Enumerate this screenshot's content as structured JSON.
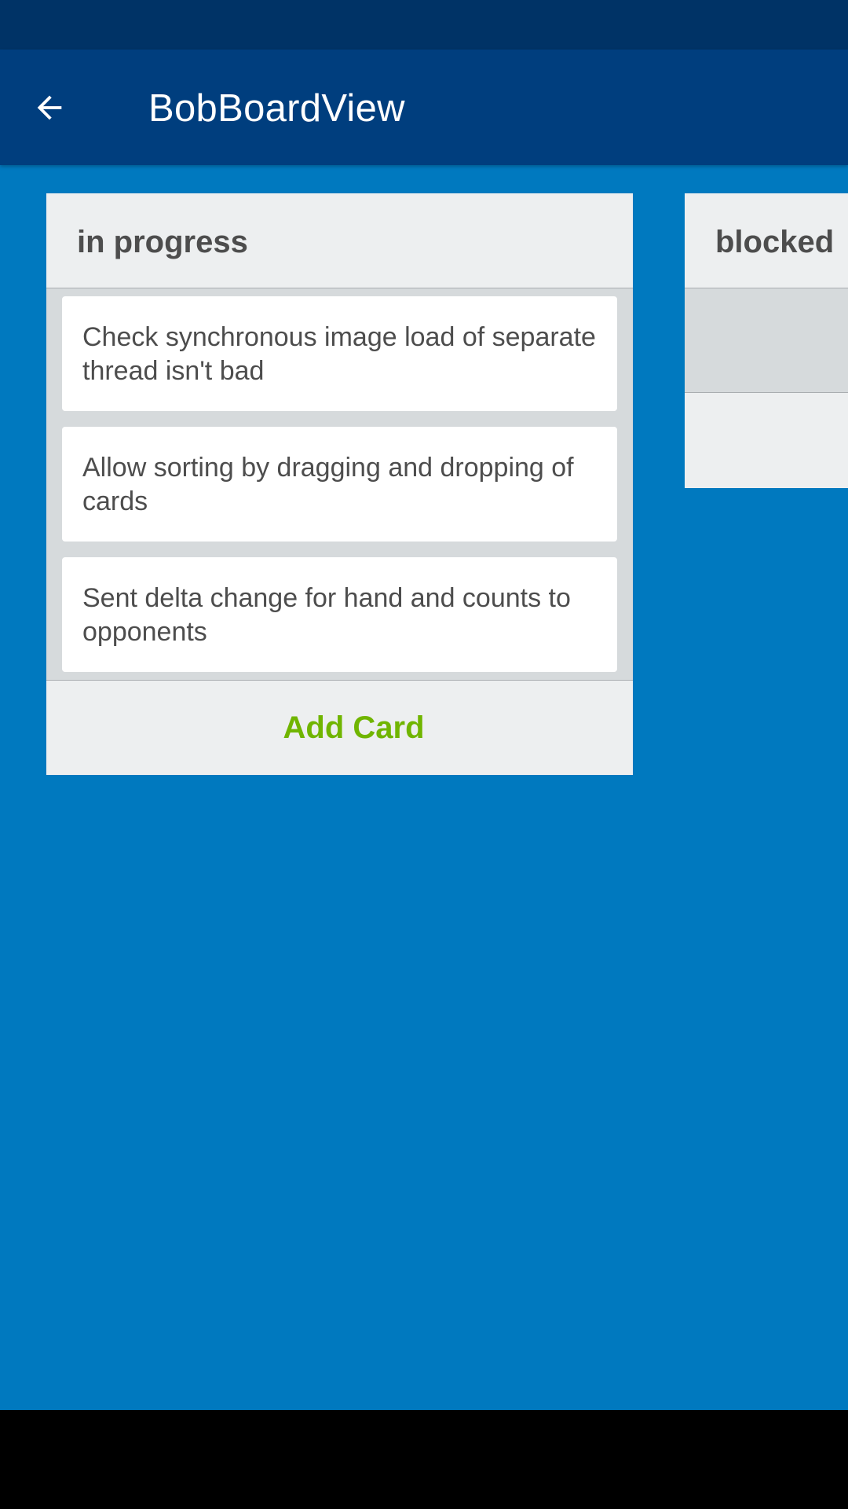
{
  "app_bar": {
    "title": "BobBoardView",
    "back_icon": "arrow-left-icon"
  },
  "lists": [
    {
      "title": "in progress",
      "cards": [
        "Check synchronous image load of separate thread isn't bad",
        "Allow sorting by dragging and dropping of cards",
        "Sent delta change for hand and counts to opponents"
      ],
      "add_card_label": "Add Card"
    },
    {
      "title": "blocked",
      "cards": []
    }
  ],
  "colors": {
    "board_background": "#0079bf",
    "app_bar": "#003e7e",
    "status_bar": "#003366",
    "add_card": "#70b500"
  }
}
